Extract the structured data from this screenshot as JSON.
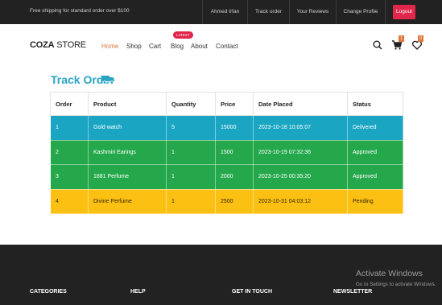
{
  "topbar": {
    "shipping_text": "Free shipping for standard order over $100",
    "links": [
      "Ahmed Irfan",
      "Track order",
      "Your Reviews",
      "Change Profile"
    ],
    "logout_label": "Logout"
  },
  "header": {
    "brand_bold": "COZA",
    "brand_light": " STORE",
    "nav": [
      "Home",
      "Shop",
      "Cart",
      "Blog",
      "About",
      "Contact"
    ],
    "active_nav": "Home",
    "blog_badge": "LATEST",
    "cart_count": "1",
    "wishlist_count": "0"
  },
  "main": {
    "title": "Track Order",
    "columns": [
      "Order",
      "Product",
      "Quantity",
      "Price",
      "Date Placed",
      "Status"
    ],
    "rows": [
      [
        "1",
        "Gold watch",
        "5",
        "15000",
        "2023-10-18 10:05:07",
        "Delivered"
      ],
      [
        "2",
        "Kashmiri Earings",
        "1",
        "1500",
        "2023-10-19 07:32:36",
        "Approved"
      ],
      [
        "3",
        "1881 Perfume",
        "1",
        "2000",
        "2023-10-25 00:35:20",
        "Approved"
      ],
      [
        "4",
        "Divine Perfume",
        "1",
        "2500",
        "2023-10-31 04:03:12",
        "Pending"
      ]
    ]
  },
  "footer": {
    "headings": [
      "CATEGORIES",
      "HELP",
      "GET IN TOUCH",
      "NEWSLETTER"
    ],
    "activate_title": "Activate Windows",
    "activate_sub": "Go to Settings to activate Windows."
  },
  "colors": {
    "accent": "#e0773c",
    "logout": "#e0264a",
    "title": "#2aa4c4",
    "delivered_row": "#1aa5c2",
    "approved_row": "#25a84b",
    "pending_row": "#fbc012"
  },
  "icons": [
    "search-icon",
    "cart-icon",
    "heart-icon",
    "truck-icon"
  ]
}
